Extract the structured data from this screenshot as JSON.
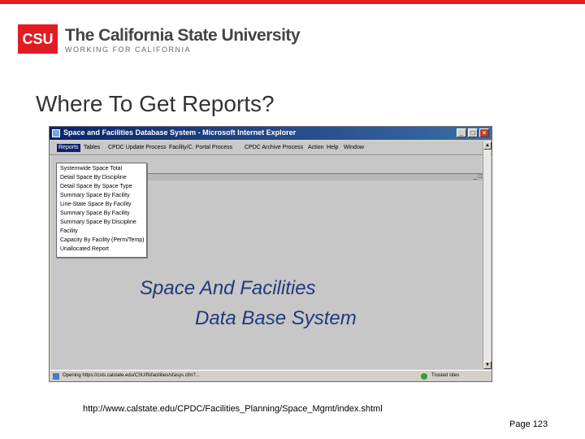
{
  "header": {
    "logo_abbr": "CSU",
    "logo_name": "The California State University",
    "logo_tagline": "WORKING FOR CALIFORNIA",
    "colors": {
      "brand_red": "#e31b23",
      "title_blue": "#1f3a7a"
    }
  },
  "slide": {
    "title": "Where To Get Reports?",
    "url": "http://www.calstate.edu/CPDC/Facilities_Planning/Space_Mgmt/index.shtml",
    "page": "Page 123"
  },
  "browser": {
    "window_title": "Space and Facilities Database System - Microsoft Internet Explorer",
    "menu": [
      "Reports",
      "Tables",
      "CPDC Update Process",
      "Facility/C. Portal Process",
      "CPDC Archive Process",
      "Action",
      "Help",
      "Window"
    ],
    "reports_menu": [
      "Systemwide Space Total",
      "Detail Space By Discipline",
      "Detail Space By Space Type",
      "Summary Space By Facility",
      "Line-State Space By Facility",
      "Summary Space By Facility",
      "Summary Space By Discipline",
      "Facility",
      "Capacity By Facility (Perm/Temp)",
      "Unallocated Report"
    ],
    "heading_line1": "Space And Facilities",
    "heading_line2": "Data Base System",
    "status_text": "Opening https://csts.calstate.edu/CSU/flsfacilities/sfasys.cfm?...",
    "status_zone": "Trusted sites"
  }
}
